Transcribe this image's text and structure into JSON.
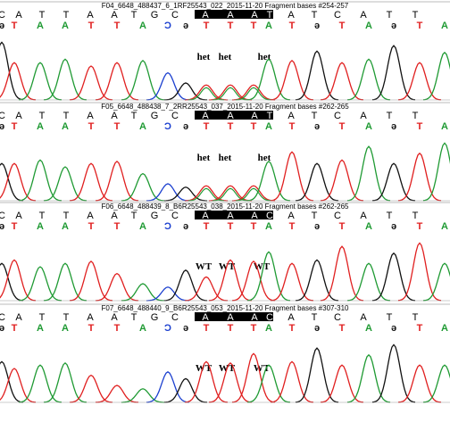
{
  "colors": {
    "A": "#1f9a33",
    "C": "#1b3fcf",
    "G": "#111111",
    "T": "#e01f1f",
    "highlight_bg": "#000000",
    "highlight_text": "#ffffff"
  },
  "reference": {
    "bases": [
      "C",
      "A",
      "T",
      "T",
      "A",
      "A",
      "T",
      "G",
      "C",
      "A",
      "A",
      "A",
      "T",
      "A",
      "T",
      "C",
      "A",
      "T",
      "T"
    ],
    "highlight_start": 9,
    "highlight_end": 12
  },
  "calls": [
    "ə",
    "T",
    "A",
    "A",
    "T",
    "T",
    "A",
    "Ɔ",
    "ə",
    "T",
    "T",
    "T",
    "A",
    "T",
    "ə",
    "T",
    "A",
    "ə",
    "T",
    "A"
  ],
  "panels": [
    {
      "title": "F04_6648_488437_6_1RF25543_022_2015-11-20 Fragment bases #254-257",
      "annotations": [
        "het",
        "het",
        "het"
      ],
      "ref_last": "T",
      "tail_calls": [
        "ə",
        "T",
        "A",
        "ə",
        "T",
        "A"
      ]
    },
    {
      "title": "F05_6648_488438_7_2RR25543_037_2015-11-20 Fragment bases #262-265",
      "annotations": [
        "het",
        "het",
        "het"
      ],
      "ref_last": "T",
      "tail_calls": [
        "ə",
        "T",
        "A",
        "ə",
        "T",
        "A"
      ]
    },
    {
      "title": "F06_6648_488439_8_B6R25543_038_2015-11-20 Fragment bases #262-265",
      "annotations": [
        "WT",
        "WT",
        "WT"
      ],
      "ref_last": "C",
      "tail_calls": [
        "ə",
        "T",
        "A",
        "ə",
        "T",
        "A"
      ]
    },
    {
      "title": "F07_6648_488440_9_B6R25543_053_2015-11-20 Fragment bases #307-310",
      "annotations": [
        "WT",
        "WT",
        "WT"
      ],
      "ref_last": "C",
      "tail_calls": [
        "ə",
        "T",
        "A",
        "ə",
        "T",
        "A"
      ]
    }
  ]
}
